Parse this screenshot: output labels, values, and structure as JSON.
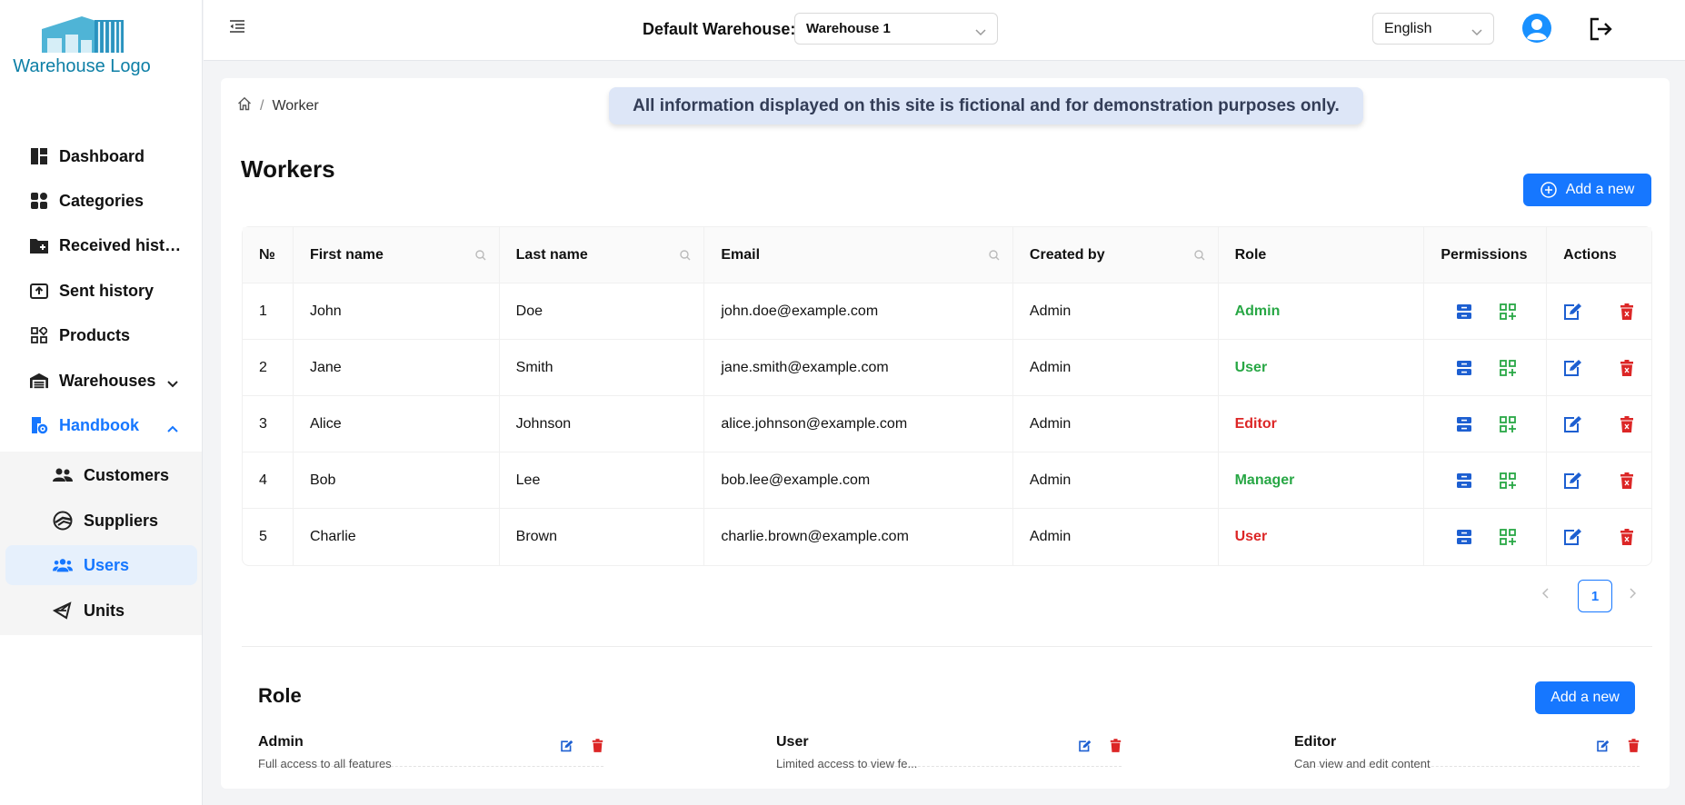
{
  "brand": {
    "logo_text": "Warehouse Logo"
  },
  "sidebar": {
    "items": [
      {
        "label": "Dashboard",
        "icon": "dashboard-icon"
      },
      {
        "label": "Categories",
        "icon": "categories-icon"
      },
      {
        "label": "Received history",
        "icon": "folder-plus-icon"
      },
      {
        "label": "Sent history",
        "icon": "upload-box-icon"
      },
      {
        "label": "Products",
        "icon": "products-icon"
      },
      {
        "label": "Warehouses",
        "icon": "warehouse-icon"
      },
      {
        "label": "Handbook",
        "icon": "handbook-icon"
      }
    ],
    "submenu": [
      {
        "label": "Customers",
        "icon": "customers-icon"
      },
      {
        "label": "Suppliers",
        "icon": "suppliers-icon"
      },
      {
        "label": "Users",
        "icon": "users-icon"
      },
      {
        "label": "Units",
        "icon": "units-icon"
      }
    ],
    "active_item": "Users"
  },
  "header": {
    "warehouse_label": "Default Warehouse:",
    "warehouse_value": "Warehouse 1",
    "language_value": "English"
  },
  "breadcrumb": {
    "current": "Worker"
  },
  "notice": "All information displayed on this site is fictional and for demonstration purposes only.",
  "page": {
    "title": "Workers",
    "add_label": "Add a new"
  },
  "table": {
    "columns": [
      "№",
      "First name",
      "Last name",
      "Email",
      "Created by",
      "Role",
      "Permissions",
      "Actions"
    ],
    "rows": [
      {
        "no": "1",
        "first": "John",
        "last": "Doe",
        "email": "john.doe@example.com",
        "created_by": "Admin",
        "role": "Admin",
        "role_color": "#28a745"
      },
      {
        "no": "2",
        "first": "Jane",
        "last": "Smith",
        "email": "jane.smith@example.com",
        "created_by": "Admin",
        "role": "User",
        "role_color": "#28a745"
      },
      {
        "no": "3",
        "first": "Alice",
        "last": "Johnson",
        "email": "alice.johnson@example.com",
        "created_by": "Admin",
        "role": "Editor",
        "role_color": "#dc2626"
      },
      {
        "no": "4",
        "first": "Bob",
        "last": "Lee",
        "email": "bob.lee@example.com",
        "created_by": "Admin",
        "role": "Manager",
        "role_color": "#28a745"
      },
      {
        "no": "5",
        "first": "Charlie",
        "last": "Brown",
        "email": "charlie.brown@example.com",
        "created_by": "Admin",
        "role": "User",
        "role_color": "#dc2626"
      }
    ]
  },
  "pagination": {
    "current_page": "1"
  },
  "roles": {
    "title": "Role",
    "add_label": "Add a new",
    "items": [
      {
        "name": "Admin",
        "description": "Full access to all features"
      },
      {
        "name": "User",
        "description": "Limited access to view fe..."
      },
      {
        "name": "Editor",
        "description": "Can view and edit content"
      }
    ]
  },
  "colors": {
    "accent": "#1677ff",
    "success": "#28a745",
    "danger": "#dc2626",
    "logo": "#0d7fa6"
  }
}
